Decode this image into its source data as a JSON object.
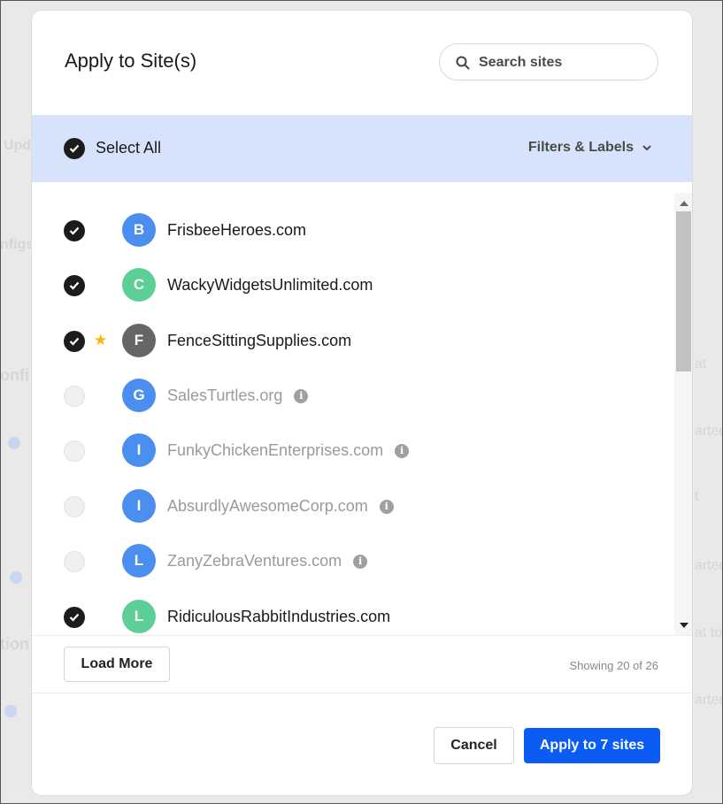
{
  "background": {
    "texts": [
      "Upd",
      "nfigs",
      "onfi",
      "tion",
      "at",
      "arted",
      "t",
      "arted",
      "at to",
      "arted"
    ]
  },
  "modal": {
    "title": "Apply to Site(s)",
    "search": {
      "placeholder": "Search sites",
      "value": "",
      "icon": "search-icon"
    },
    "select_all": {
      "label": "Select All",
      "checked": true
    },
    "filters_label": "Filters & Labels",
    "sites": [
      {
        "letter": "B",
        "name": "FrisbeeHeroes.com",
        "checked": true,
        "starred": false,
        "enabled": true,
        "info": false,
        "avatar_color": "#4a8ef0"
      },
      {
        "letter": "C",
        "name": "WackyWidgetsUnlimited.com",
        "checked": true,
        "starred": false,
        "enabled": true,
        "info": false,
        "avatar_color": "#5ccf96"
      },
      {
        "letter": "F",
        "name": "FenceSittingSupplies.com",
        "checked": true,
        "starred": true,
        "enabled": true,
        "info": false,
        "avatar_color": "#666666"
      },
      {
        "letter": "G",
        "name": "SalesTurtles.org",
        "checked": false,
        "starred": false,
        "enabled": false,
        "info": true,
        "avatar_color": "#4a8ef0"
      },
      {
        "letter": "I",
        "name": "FunkyChickenEnterprises.com",
        "checked": false,
        "starred": false,
        "enabled": false,
        "info": true,
        "avatar_color": "#4a8ef0"
      },
      {
        "letter": "I",
        "name": "AbsurdlyAwesomeCorp.com",
        "checked": false,
        "starred": false,
        "enabled": false,
        "info": true,
        "avatar_color": "#4a8ef0"
      },
      {
        "letter": "L",
        "name": "ZanyZebraVentures.com",
        "checked": false,
        "starred": false,
        "enabled": false,
        "info": true,
        "avatar_color": "#4a8ef0"
      },
      {
        "letter": "L",
        "name": "RidiculousRabbitIndustries.com",
        "checked": true,
        "starred": false,
        "enabled": true,
        "info": false,
        "avatar_color": "#5ccf96"
      }
    ],
    "load_more_label": "Load More",
    "showing_text": "Showing 20 of 26",
    "cancel_label": "Cancel",
    "apply_label": "Apply to 7 sites",
    "colors": {
      "accent": "#0a5cf5",
      "select_bar": "#d6e3fb",
      "star": "#f5b800"
    }
  }
}
